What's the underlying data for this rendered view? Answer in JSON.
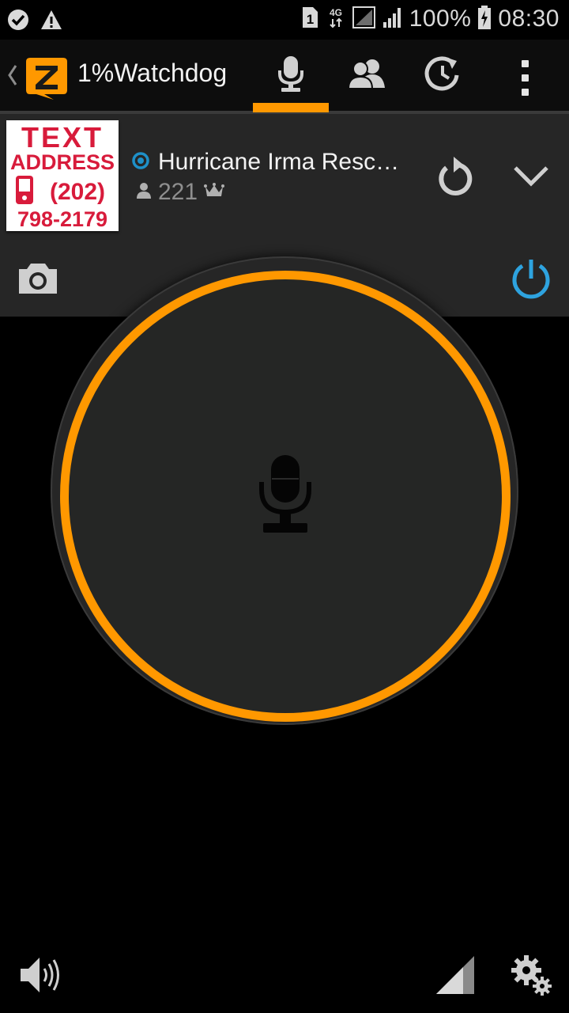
{
  "status_bar": {
    "sim_slot": "1",
    "network": "4G",
    "battery": "100%",
    "time": "08:30"
  },
  "app_bar": {
    "title": "1%Watchdog",
    "tabs": [
      {
        "name": "talk",
        "icon": "microphone-icon",
        "active": true
      },
      {
        "name": "contacts",
        "icon": "users-icon",
        "active": false
      },
      {
        "name": "recents",
        "icon": "recents-icon",
        "active": false
      }
    ]
  },
  "channel": {
    "name": "Hurricane Irma Resc…",
    "user_count": "221",
    "status": "online",
    "image_text": {
      "line1": "TEXT",
      "line2": "ADDRESS",
      "line3": "(202)",
      "line4": "798-2179"
    }
  },
  "colors": {
    "accent": "#ff9800",
    "online": "#1e90c8",
    "panel": "#262626",
    "background": "#000000"
  }
}
